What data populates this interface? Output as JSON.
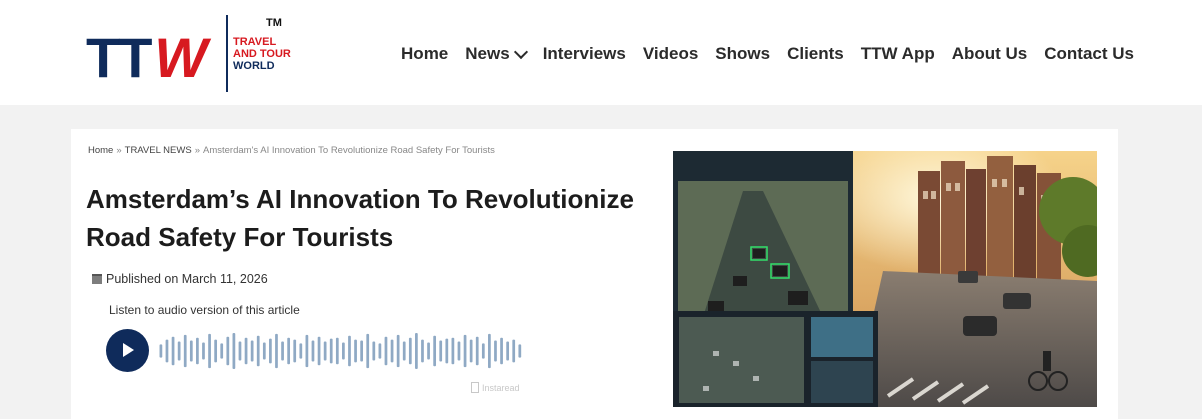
{
  "header": {
    "logo": {
      "letters_tt": "TT",
      "letters_w": "W",
      "tm": "TM",
      "line1": "TRAVEL",
      "line2": "AND TOUR",
      "line3": "WORLD"
    },
    "nav": [
      {
        "label": "Home"
      },
      {
        "label": "News",
        "has_dropdown": true
      },
      {
        "label": "Interviews"
      },
      {
        "label": "Videos"
      },
      {
        "label": "Shows"
      },
      {
        "label": "Clients"
      },
      {
        "label": "TTW App"
      },
      {
        "label": "About Us"
      },
      {
        "label": "Contact Us"
      }
    ]
  },
  "breadcrumb": {
    "home": "Home",
    "section": "TRAVEL NEWS",
    "current": "Amsterdam's AI Innovation To Revolutionize Road Safety For Tourists"
  },
  "article": {
    "title_line1": "Amsterdam’s AI Innovation To Revolutionize",
    "title_line2": "Road Safety  For Tourists",
    "published": "Published on March 11, 2026"
  },
  "audio": {
    "listen_label": "Listen to audio version of this article",
    "provider": "Instaread",
    "levels": [
      0.35,
      0.6,
      0.75,
      0.5,
      0.85,
      0.55,
      0.7,
      0.45,
      0.9,
      0.6,
      0.4,
      0.75,
      0.95,
      0.5,
      0.7,
      0.55,
      0.8,
      0.45,
      0.65,
      0.9,
      0.5,
      0.7,
      0.6,
      0.4,
      0.85,
      0.55,
      0.75,
      0.5,
      0.65,
      0.7,
      0.45,
      0.8,
      0.6,
      0.55,
      0.9,
      0.5,
      0.4,
      0.75,
      0.6,
      0.85,
      0.5,
      0.7,
      0.95,
      0.6,
      0.45,
      0.8,
      0.55,
      0.65,
      0.7,
      0.5,
      0.85,
      0.6,
      0.75,
      0.4,
      0.9,
      0.55,
      0.7,
      0.5,
      0.6,
      0.35
    ],
    "bar_color": "#8fa9c4"
  },
  "colors": {
    "brand_navy": "#0f2b5b",
    "brand_red": "#d71920",
    "nav_text": "#2b2b2b"
  }
}
